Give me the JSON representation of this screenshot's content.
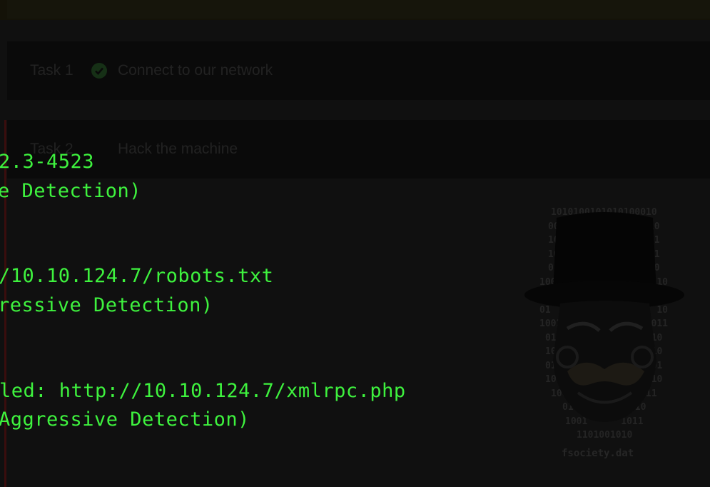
{
  "background_ui": {
    "tasks": [
      {
        "number": "Task 1",
        "title": "Connect to our network",
        "completed": true
      },
      {
        "number": "Task 2",
        "title": "Hack the machine",
        "completed": false
      }
    ]
  },
  "terminal": {
    "lines": [
      "2.3-4523",
      "e Detection)",
      "/10.10.124.7/robots.txt",
      "ressive Detection)",
      "led: http://10.10.124.7/xmlrpc.php",
      "Aggressive Detection)"
    ],
    "text_color": "#3ef23e"
  },
  "artwork": {
    "name": "fsociety mask",
    "caption": "fsociety.dat",
    "binary_rows": [
      "1010100101010100010",
      "00                10",
      "10                11",
      "10                01",
      "01                00",
      "1001                110",
      "1                    1",
      "01                   10",
      "1001                011",
      "01                 10",
      "10                 10",
      "01                 01",
      "10                 10",
      "10011          0111",
      "0101        010",
      "1001      1011",
      "1101001010"
    ],
    "colors": {
      "hat": "#050505",
      "text": "#242424"
    }
  }
}
